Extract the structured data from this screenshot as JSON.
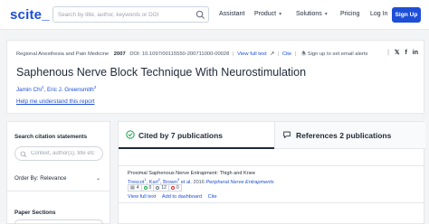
{
  "nav": {
    "logo": "scite_",
    "search_placeholder": "Search by title, author, keywords or DOI",
    "links": {
      "assistant": "Assistant",
      "product": "Product",
      "solutions": "Solutions",
      "pricing": "Pricing",
      "login": "Log In"
    },
    "signup": "Sign Up"
  },
  "article": {
    "journal": "Regional Anesthesia and Pain Medicine",
    "year": "2007",
    "doi": "DOI: 10.1097/00115550-200711000-00028",
    "view_full_text": "View full text",
    "cite": "Cite",
    "alerts": "Sign up to set email alerts",
    "title": "Saphenous Nerve Block Technique With Neurostimulation",
    "authors": [
      {
        "name": "Jamin Chi",
        "sup": "1"
      },
      {
        "name": "Eric J. Greensmith",
        "sup": "2"
      }
    ],
    "help_link": "Help me understand this report"
  },
  "sidebar": {
    "search_heading": "Search citation statements",
    "search_placeholder": "Context, author(s), title etc",
    "order_by": "Order By: Relevance",
    "paper_sections": "Paper Sections"
  },
  "tabs": {
    "cited_by": "Cited by 7 publications",
    "references": "References 2 publications"
  },
  "citation": {
    "title": "Proximal Saphenous Nerve Entrapment: Thigh and Knee",
    "authors": [
      {
        "name": "Trescot",
        "sup": "1"
      },
      {
        "name": "Karl",
        "sup": "2"
      },
      {
        "name": "Brown",
        "sup": "3"
      }
    ],
    "et_al": "et al.",
    "year": "2016",
    "journal": "Peripheral Nerve Entrapments",
    "stats": {
      "reports": "4",
      "supporting": "0",
      "mentioning": "12",
      "contrasting": "0"
    },
    "actions": {
      "view_full_text": "View full text",
      "add_to_dashboard": "Add to dashboard",
      "cite": "Cite"
    }
  },
  "colors": {
    "brand": "#1d4ed8",
    "supporting": "#16a34a",
    "contrasting": "#dc2626",
    "mentioning": "#6b7280"
  }
}
